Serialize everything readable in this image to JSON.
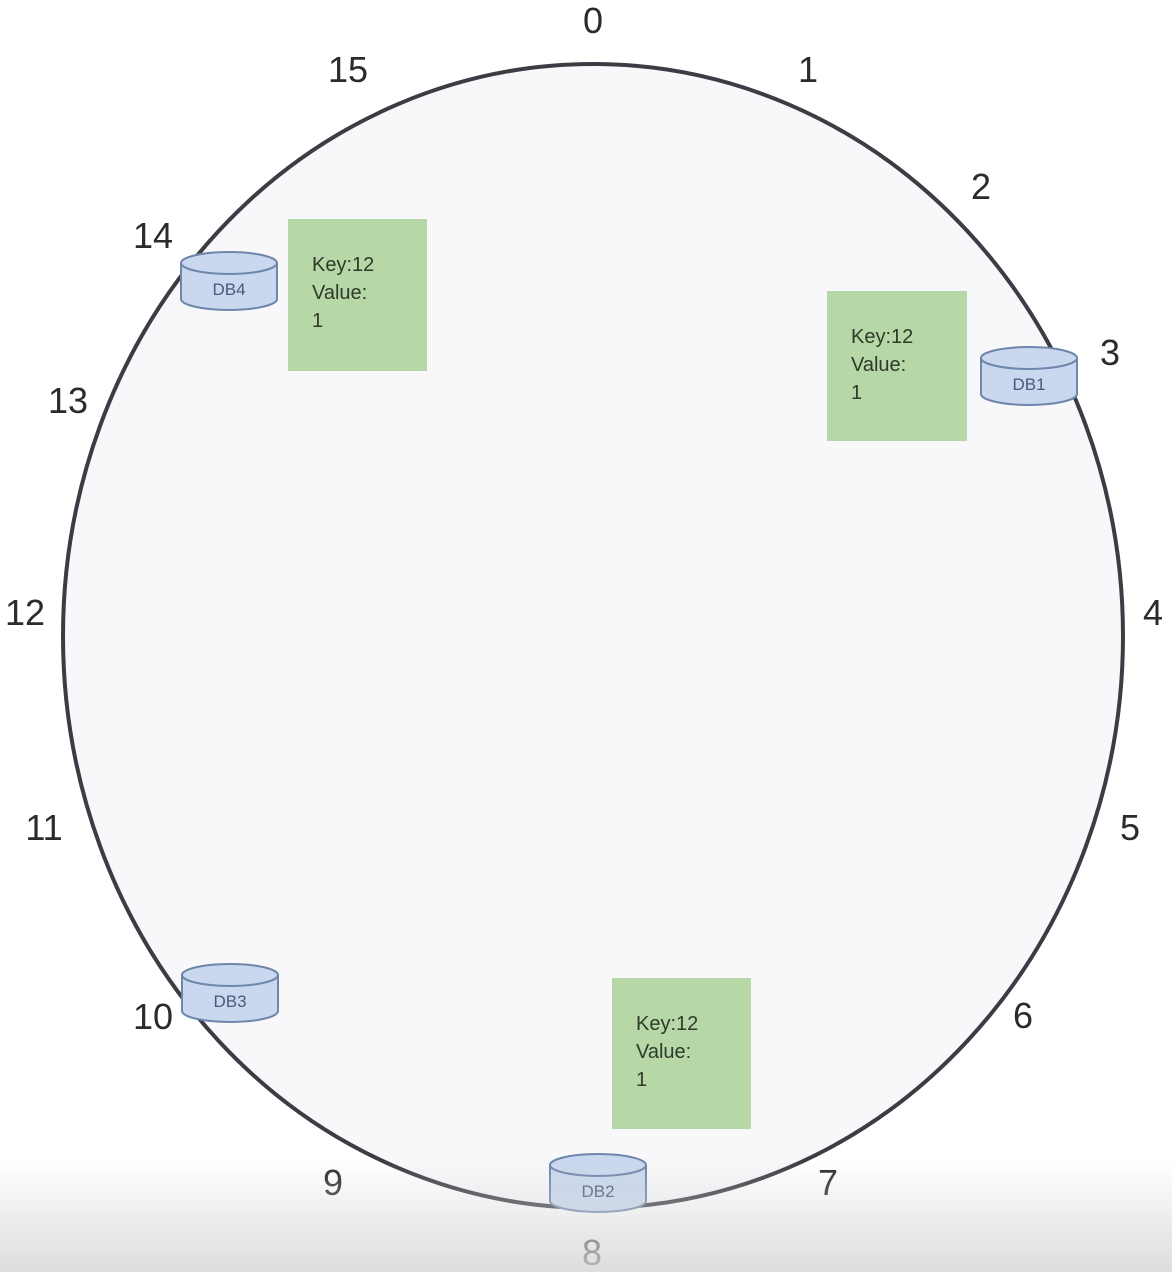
{
  "ring": {
    "positions": [
      "0",
      "1",
      "2",
      "3",
      "4",
      "5",
      "6",
      "7",
      "8",
      "9",
      "10",
      "11",
      "12",
      "13",
      "14",
      "15"
    ],
    "fill_color": "#f8f8fa",
    "stroke_color": "#3a3d44"
  },
  "databases": [
    {
      "label": "DB1",
      "position": 3
    },
    {
      "label": "DB2",
      "position": 8
    },
    {
      "label": "DB3",
      "position": 10
    },
    {
      "label": "DB4",
      "position": 14
    }
  ],
  "db_colors": {
    "fill": "#c9d8ee",
    "stroke": "#6f86ab",
    "text": "#4a5a78"
  },
  "key_value_boxes": [
    {
      "lines": [
        "Key:12",
        "Value:",
        "1"
      ],
      "near_db": "DB4"
    },
    {
      "lines": [
        "Key:12",
        "Value:",
        "1"
      ],
      "near_db": "DB1"
    },
    {
      "lines": [
        "Key:12",
        "Value:",
        "1"
      ],
      "near_db": "DB2"
    }
  ],
  "box_colors": {
    "fill": "#b5d8a6",
    "text": "#2e3a2a"
  }
}
